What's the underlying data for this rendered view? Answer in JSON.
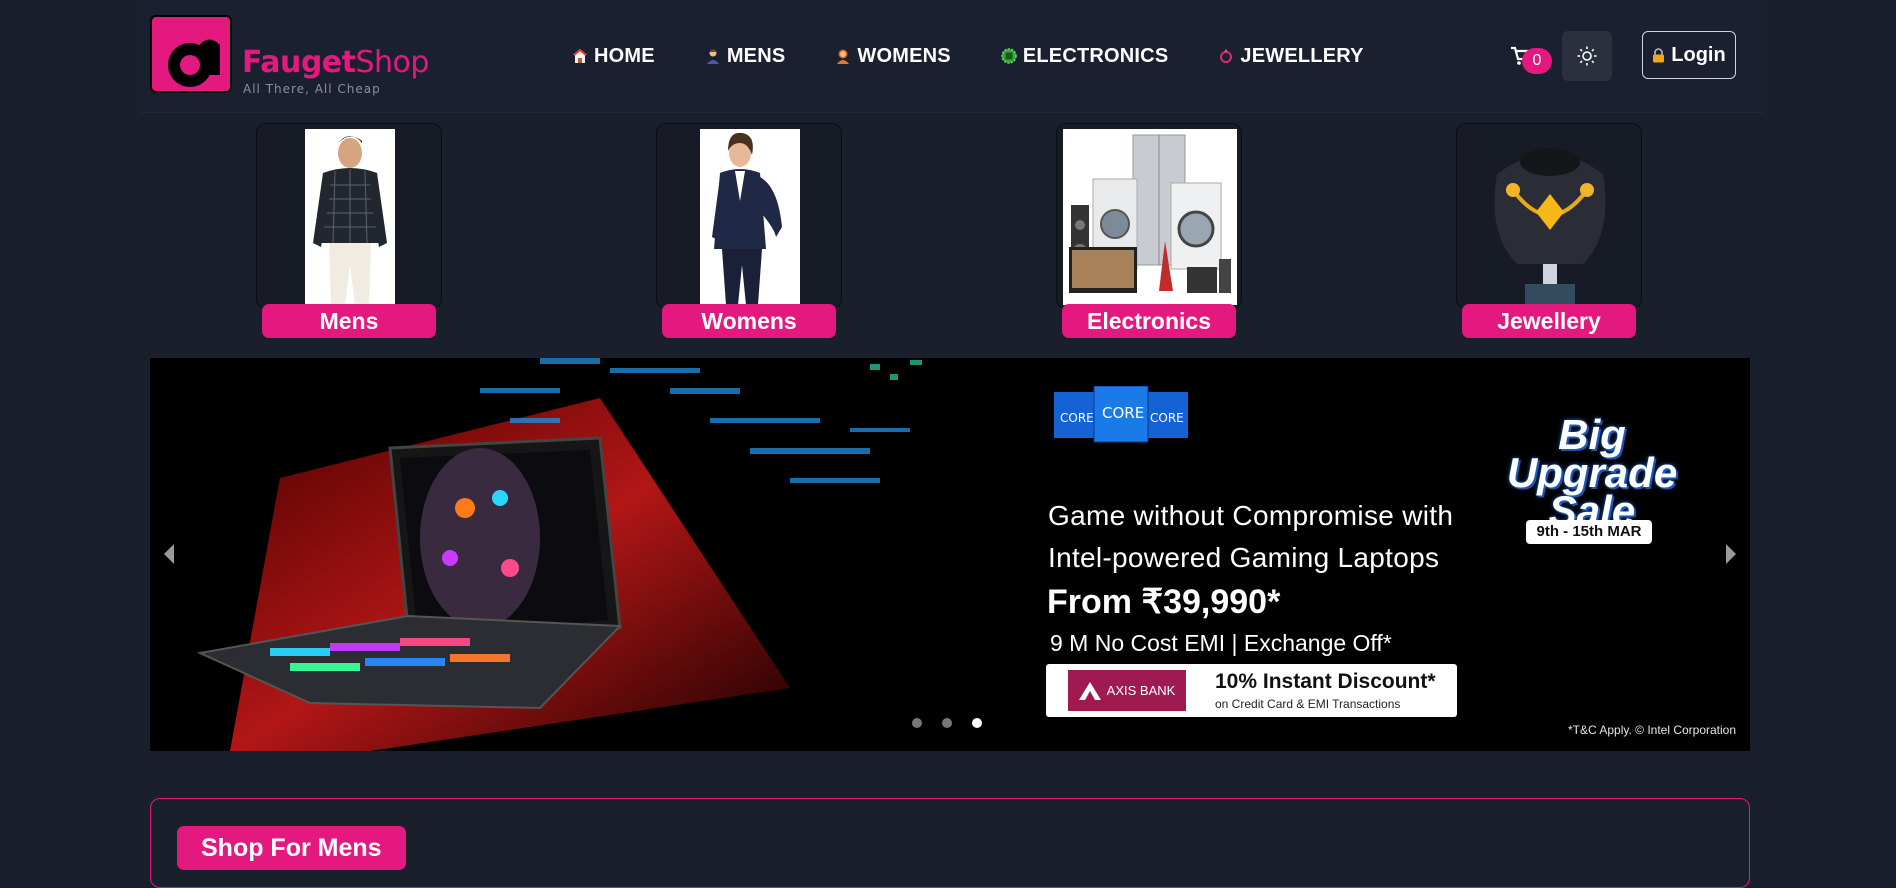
{
  "brand": {
    "name_bold": "Fauget",
    "name_light": "Shop",
    "tagline": "All There, All Cheap",
    "color": "#e3197f"
  },
  "nav": {
    "items": [
      {
        "label": "HOME",
        "icon": "house-icon"
      },
      {
        "label": "MENS",
        "icon": "man-icon"
      },
      {
        "label": "WOMENS",
        "icon": "woman-icon"
      },
      {
        "label": "ELECTRONICS",
        "icon": "chip-icon"
      },
      {
        "label": "JEWELLERY",
        "icon": "ring-icon"
      }
    ],
    "cart_count": "0",
    "login_label": "Login"
  },
  "categories": [
    {
      "label": "Mens",
      "icon": "mens-shirt-image"
    },
    {
      "label": "Womens",
      "icon": "womens-blazer-image"
    },
    {
      "label": "Electronics",
      "icon": "appliances-image"
    },
    {
      "label": "Jewellery",
      "icon": "necklace-image"
    }
  ],
  "banner": {
    "line1": "Game without Compromise with",
    "line2": "Intel-powered Gaming Laptops",
    "price": "From ₹39,990*",
    "emi": "9 M No Cost EMI | Exchange Off*",
    "bank": "AXIS BANK",
    "discount": "10% Instant Discount*",
    "discount_sub": "on Credit Card & EMI Transactions",
    "sale_title": "Big Upgrade Sale",
    "sale_dates": "9th - 15th MAR",
    "terms": "*T&C Apply. © Intel Corporation",
    "slides": 3,
    "active_slide": 3
  },
  "shop_section": {
    "title": "Shop For Mens"
  },
  "colors": {
    "background": "#1a1f2c",
    "accent": "#e3197f"
  }
}
